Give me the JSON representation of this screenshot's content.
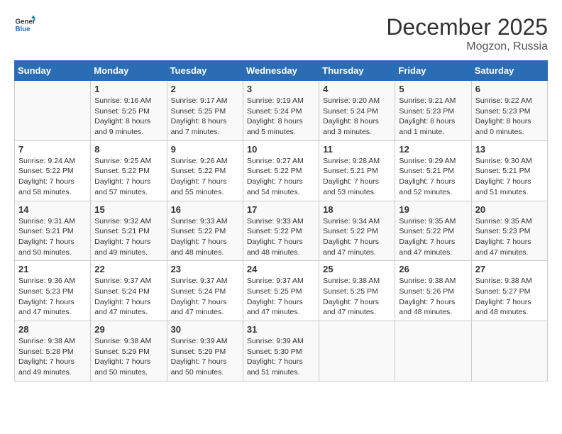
{
  "header": {
    "logo": {
      "general": "General",
      "blue": "Blue"
    },
    "title": "December 2025",
    "subtitle": "Mogzon, Russia"
  },
  "calendar": {
    "weekdays": [
      "Sunday",
      "Monday",
      "Tuesday",
      "Wednesday",
      "Thursday",
      "Friday",
      "Saturday"
    ],
    "weeks": [
      [
        {
          "day": "",
          "sunrise": "",
          "sunset": "",
          "daylight": ""
        },
        {
          "day": "1",
          "sunrise": "Sunrise: 9:16 AM",
          "sunset": "Sunset: 5:25 PM",
          "daylight": "Daylight: 8 hours and 9 minutes."
        },
        {
          "day": "2",
          "sunrise": "Sunrise: 9:17 AM",
          "sunset": "Sunset: 5:25 PM",
          "daylight": "Daylight: 8 hours and 7 minutes."
        },
        {
          "day": "3",
          "sunrise": "Sunrise: 9:19 AM",
          "sunset": "Sunset: 5:24 PM",
          "daylight": "Daylight: 8 hours and 5 minutes."
        },
        {
          "day": "4",
          "sunrise": "Sunrise: 9:20 AM",
          "sunset": "Sunset: 5:24 PM",
          "daylight": "Daylight: 8 hours and 3 minutes."
        },
        {
          "day": "5",
          "sunrise": "Sunrise: 9:21 AM",
          "sunset": "Sunset: 5:23 PM",
          "daylight": "Daylight: 8 hours and 1 minute."
        },
        {
          "day": "6",
          "sunrise": "Sunrise: 9:22 AM",
          "sunset": "Sunset: 5:23 PM",
          "daylight": "Daylight: 8 hours and 0 minutes."
        }
      ],
      [
        {
          "day": "7",
          "sunrise": "Sunrise: 9:24 AM",
          "sunset": "Sunset: 5:22 PM",
          "daylight": "Daylight: 7 hours and 58 minutes."
        },
        {
          "day": "8",
          "sunrise": "Sunrise: 9:25 AM",
          "sunset": "Sunset: 5:22 PM",
          "daylight": "Daylight: 7 hours and 57 minutes."
        },
        {
          "day": "9",
          "sunrise": "Sunrise: 9:26 AM",
          "sunset": "Sunset: 5:22 PM",
          "daylight": "Daylight: 7 hours and 55 minutes."
        },
        {
          "day": "10",
          "sunrise": "Sunrise: 9:27 AM",
          "sunset": "Sunset: 5:22 PM",
          "daylight": "Daylight: 7 hours and 54 minutes."
        },
        {
          "day": "11",
          "sunrise": "Sunrise: 9:28 AM",
          "sunset": "Sunset: 5:21 PM",
          "daylight": "Daylight: 7 hours and 53 minutes."
        },
        {
          "day": "12",
          "sunrise": "Sunrise: 9:29 AM",
          "sunset": "Sunset: 5:21 PM",
          "daylight": "Daylight: 7 hours and 52 minutes."
        },
        {
          "day": "13",
          "sunrise": "Sunrise: 9:30 AM",
          "sunset": "Sunset: 5:21 PM",
          "daylight": "Daylight: 7 hours and 51 minutes."
        }
      ],
      [
        {
          "day": "14",
          "sunrise": "Sunrise: 9:31 AM",
          "sunset": "Sunset: 5:21 PM",
          "daylight": "Daylight: 7 hours and 50 minutes."
        },
        {
          "day": "15",
          "sunrise": "Sunrise: 9:32 AM",
          "sunset": "Sunset: 5:21 PM",
          "daylight": "Daylight: 7 hours and 49 minutes."
        },
        {
          "day": "16",
          "sunrise": "Sunrise: 9:33 AM",
          "sunset": "Sunset: 5:22 PM",
          "daylight": "Daylight: 7 hours and 48 minutes."
        },
        {
          "day": "17",
          "sunrise": "Sunrise: 9:33 AM",
          "sunset": "Sunset: 5:22 PM",
          "daylight": "Daylight: 7 hours and 48 minutes."
        },
        {
          "day": "18",
          "sunrise": "Sunrise: 9:34 AM",
          "sunset": "Sunset: 5:22 PM",
          "daylight": "Daylight: 7 hours and 47 minutes."
        },
        {
          "day": "19",
          "sunrise": "Sunrise: 9:35 AM",
          "sunset": "Sunset: 5:22 PM",
          "daylight": "Daylight: 7 hours and 47 minutes."
        },
        {
          "day": "20",
          "sunrise": "Sunrise: 9:35 AM",
          "sunset": "Sunset: 5:23 PM",
          "daylight": "Daylight: 7 hours and 47 minutes."
        }
      ],
      [
        {
          "day": "21",
          "sunrise": "Sunrise: 9:36 AM",
          "sunset": "Sunset: 5:23 PM",
          "daylight": "Daylight: 7 hours and 47 minutes."
        },
        {
          "day": "22",
          "sunrise": "Sunrise: 9:37 AM",
          "sunset": "Sunset: 5:24 PM",
          "daylight": "Daylight: 7 hours and 47 minutes."
        },
        {
          "day": "23",
          "sunrise": "Sunrise: 9:37 AM",
          "sunset": "Sunset: 5:24 PM",
          "daylight": "Daylight: 7 hours and 47 minutes."
        },
        {
          "day": "24",
          "sunrise": "Sunrise: 9:37 AM",
          "sunset": "Sunset: 5:25 PM",
          "daylight": "Daylight: 7 hours and 47 minutes."
        },
        {
          "day": "25",
          "sunrise": "Sunrise: 9:38 AM",
          "sunset": "Sunset: 5:25 PM",
          "daylight": "Daylight: 7 hours and 47 minutes."
        },
        {
          "day": "26",
          "sunrise": "Sunrise: 9:38 AM",
          "sunset": "Sunset: 5:26 PM",
          "daylight": "Daylight: 7 hours and 48 minutes."
        },
        {
          "day": "27",
          "sunrise": "Sunrise: 9:38 AM",
          "sunset": "Sunset: 5:27 PM",
          "daylight": "Daylight: 7 hours and 48 minutes."
        }
      ],
      [
        {
          "day": "28",
          "sunrise": "Sunrise: 9:38 AM",
          "sunset": "Sunset: 5:28 PM",
          "daylight": "Daylight: 7 hours and 49 minutes."
        },
        {
          "day": "29",
          "sunrise": "Sunrise: 9:38 AM",
          "sunset": "Sunset: 5:29 PM",
          "daylight": "Daylight: 7 hours and 50 minutes."
        },
        {
          "day": "30",
          "sunrise": "Sunrise: 9:39 AM",
          "sunset": "Sunset: 5:29 PM",
          "daylight": "Daylight: 7 hours and 50 minutes."
        },
        {
          "day": "31",
          "sunrise": "Sunrise: 9:39 AM",
          "sunset": "Sunset: 5:30 PM",
          "daylight": "Daylight: 7 hours and 51 minutes."
        },
        {
          "day": "",
          "sunrise": "",
          "sunset": "",
          "daylight": ""
        },
        {
          "day": "",
          "sunrise": "",
          "sunset": "",
          "daylight": ""
        },
        {
          "day": "",
          "sunrise": "",
          "sunset": "",
          "daylight": ""
        }
      ]
    ]
  }
}
